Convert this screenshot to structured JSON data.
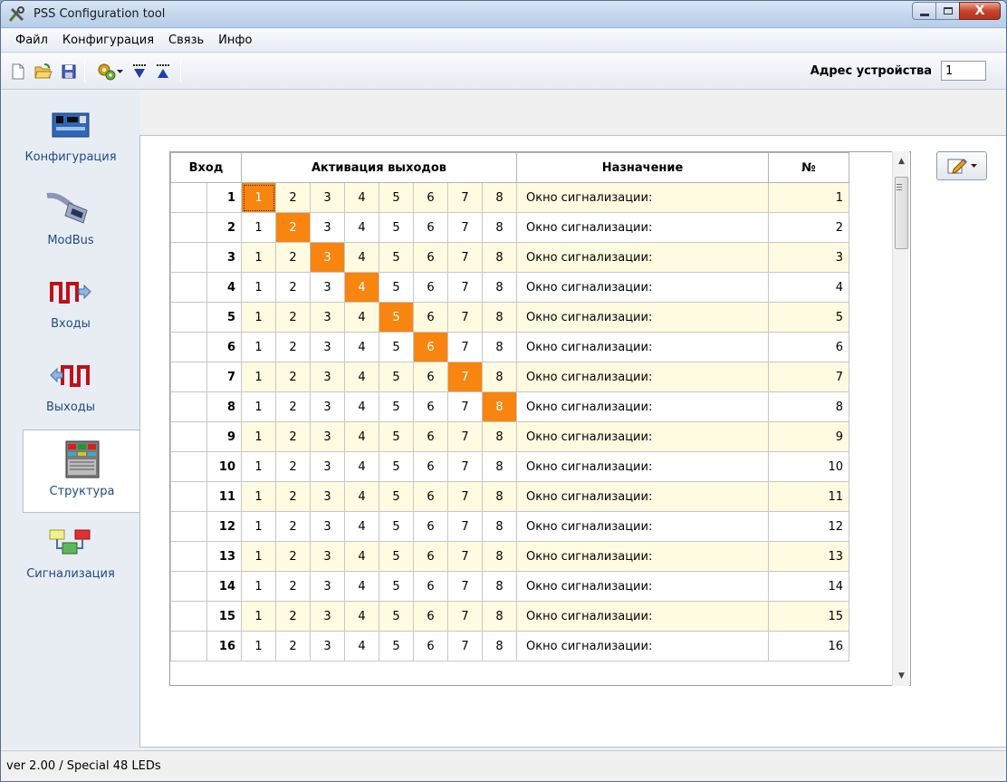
{
  "window": {
    "title": "PSS Configuration tool",
    "close_glyph": "X"
  },
  "menu": [
    "Файл",
    "Конфигурация",
    "Связь",
    "Инфо"
  ],
  "toolbar": {
    "icons": [
      "new-file-icon",
      "open-folder-icon",
      "save-icon",
      "gears-icon",
      "download-icon",
      "upload-icon"
    ],
    "address_label": "Адрес устройства",
    "address_value": "1"
  },
  "sidenav": {
    "active": "Структура",
    "items": [
      {
        "label": "Конфигурация",
        "icon": "circuit-board-icon"
      },
      {
        "label": "ModBus",
        "icon": "serial-cable-icon"
      },
      {
        "label": "Входы",
        "icon": "pulse-in-icon"
      },
      {
        "label": "Выходы",
        "icon": "pulse-out-icon"
      },
      {
        "label": "Структура",
        "icon": "panel-rack-icon"
      },
      {
        "label": "Сигнализация",
        "icon": "blocks-icon"
      }
    ]
  },
  "grid": {
    "headers": {
      "input": "Вход",
      "outputs": "Активация выходов",
      "assignment": "Назначение",
      "number": "№"
    },
    "output_labels": [
      "1",
      "2",
      "3",
      "4",
      "5",
      "6",
      "7",
      "8"
    ],
    "rows": [
      {
        "input": "1",
        "active": 1,
        "assignment": "Окно сигнализации:",
        "number": "1"
      },
      {
        "input": "2",
        "active": 2,
        "assignment": "Окно сигнализации:",
        "number": "2"
      },
      {
        "input": "3",
        "active": 3,
        "assignment": "Окно сигнализации:",
        "number": "3"
      },
      {
        "input": "4",
        "active": 4,
        "assignment": "Окно сигнализации:",
        "number": "4"
      },
      {
        "input": "5",
        "active": 5,
        "assignment": "Окно сигнализации:",
        "number": "5"
      },
      {
        "input": "6",
        "active": 6,
        "assignment": "Окно сигнализации:",
        "number": "6"
      },
      {
        "input": "7",
        "active": 7,
        "assignment": "Окно сигнализации:",
        "number": "7"
      },
      {
        "input": "8",
        "active": 8,
        "assignment": "Окно сигнализации:",
        "number": "8"
      },
      {
        "input": "9",
        "active": 0,
        "assignment": "Окно сигнализации:",
        "number": "9"
      },
      {
        "input": "10",
        "active": 0,
        "assignment": "Окно сигнализации:",
        "number": "10"
      },
      {
        "input": "11",
        "active": 0,
        "assignment": "Окно сигнализации:",
        "number": "11"
      },
      {
        "input": "12",
        "active": 0,
        "assignment": "Окно сигнализации:",
        "number": "12"
      },
      {
        "input": "13",
        "active": 0,
        "assignment": "Окно сигнализации:",
        "number": "13"
      },
      {
        "input": "14",
        "active": 0,
        "assignment": "Окно сигнализации:",
        "number": "14"
      },
      {
        "input": "15",
        "active": 0,
        "assignment": "Окно сигнализации:",
        "number": "15"
      },
      {
        "input": "16",
        "active": 0,
        "assignment": "Окно сигнализации:",
        "number": "16"
      }
    ]
  },
  "colors": {
    "active_output": "#f7850f",
    "odd_row": "#fffbe1",
    "nav_text": "#1f4a85"
  },
  "statusbar": {
    "text": "ver 2.00  /  Special 48 LEDs"
  }
}
